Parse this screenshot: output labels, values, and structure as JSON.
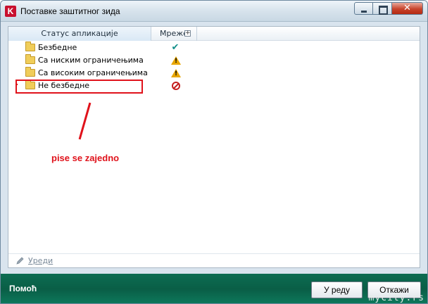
{
  "window": {
    "title": "Поставке заштитног зида",
    "logo_letter": "K"
  },
  "table": {
    "columns": [
      "Статус апликације",
      "Мреже"
    ],
    "expand_symbol": "+",
    "rows": [
      {
        "label": "Безбедне",
        "status_icon": "checkmark-icon",
        "status_color": "#138f8a"
      },
      {
        "label": "Са ниским ограничењима",
        "status_icon": "warning-icon",
        "status_color": "#e8a600"
      },
      {
        "label": "Са високим ограничењима",
        "status_icon": "warning-icon",
        "status_color": "#e8a600"
      },
      {
        "label": "Не безбедне",
        "status_icon": "blocked-icon",
        "status_color": "#c41e1e"
      }
    ]
  },
  "annotation": {
    "text": "pise se zajedno",
    "color": "#e0121b"
  },
  "editbar": {
    "edit_label": "Уреди"
  },
  "footer": {
    "help_label": "Помоћ",
    "ok_label": "У реду",
    "cancel_label": "Откажи",
    "background": "#0a5e46"
  },
  "watermark": "mycity.rs"
}
